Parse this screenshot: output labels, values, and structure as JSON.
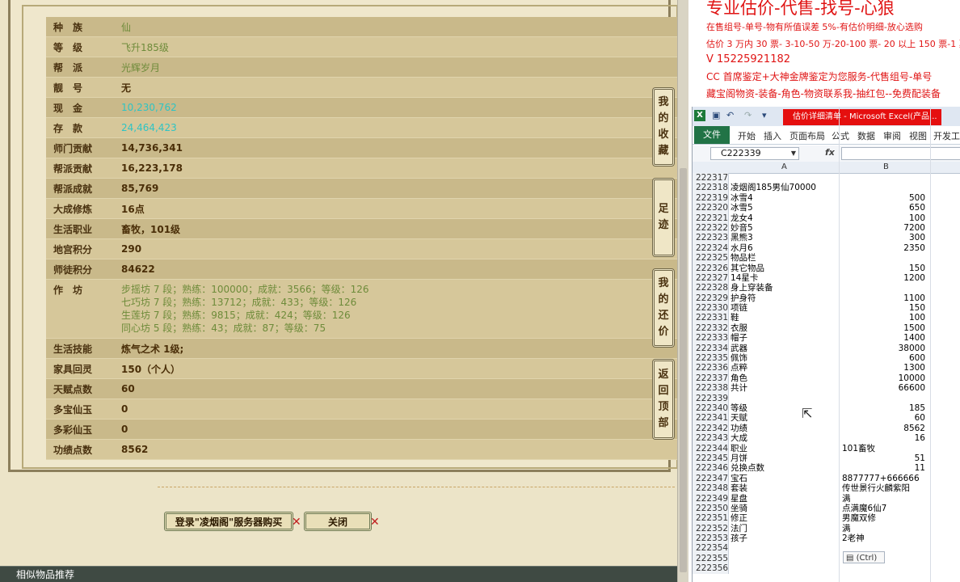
{
  "stats": [
    {
      "label": "种　族",
      "value": "仙",
      "style": "green"
    },
    {
      "label": "等　级",
      "value": "飞升185级",
      "style": "green"
    },
    {
      "label": "帮　派",
      "value": "光辉岁月",
      "style": "green"
    },
    {
      "label": "靓　号",
      "value": "无",
      "style": "bold"
    },
    {
      "label": "现　金",
      "value": "10,230,762",
      "style": "cyan"
    },
    {
      "label": "存　款",
      "value": "24,464,423",
      "style": "cyan"
    },
    {
      "label": "师门贡献",
      "value": "14,736,341",
      "style": "bold"
    },
    {
      "label": "帮派贡献",
      "value": "16,223,178",
      "style": "bold"
    },
    {
      "label": "帮派成就",
      "value": "85,769",
      "style": "bold"
    },
    {
      "label": "大成修炼",
      "value": "16点",
      "style": "bold"
    },
    {
      "label": "生活职业",
      "value": "畜牧，101级",
      "style": "bold"
    },
    {
      "label": "地宫积分",
      "value": "290",
      "style": "bold"
    },
    {
      "label": "师徒积分",
      "value": "84622",
      "style": "bold"
    }
  ],
  "workshop": {
    "label": "作　坊",
    "lines": [
      "步摇坊 7 段；熟练：100000；成就：3566；等级：126",
      "七巧坊 7 段；熟练：13712；成就：433；等级：126",
      "生莲坊 7 段；熟练：9815；成就：424；等级：126",
      "同心坊 5 段；熟练：43；成就：87；等级：75"
    ]
  },
  "stats2": [
    {
      "label": "生活技能",
      "value": "炼气之术 1级;"
    },
    {
      "label": "家具回灵",
      "value": "150（个人）"
    },
    {
      "label": "天赋点数",
      "value": "60"
    },
    {
      "label": "多宝仙玉",
      "value": "0"
    },
    {
      "label": "多彩仙玉",
      "value": "0"
    },
    {
      "label": "功绩点数",
      "value": "8562"
    }
  ],
  "side_buttons": {
    "favorite": [
      "我",
      "的",
      "收",
      "藏"
    ],
    "footprint": [
      "足",
      "迹"
    ],
    "my_offer": [
      "我",
      "的",
      "还",
      "价"
    ],
    "back_top": [
      "返",
      "回",
      "顶",
      "部"
    ]
  },
  "actions": {
    "login_buy": "登录\"凌烟阁\"服务器购买",
    "close": "关闭"
  },
  "similar_bar": "相似物品推荐",
  "doc": {
    "line0": "专业估价-代售-找号-心狼",
    "line1": "在售组号-单号-物有所值误差 5%-有估价明细-放心选购",
    "line2": "估价 3 万内 30 票- 3-10-50 万-20-100 票- 20 以上 150 票-1 票",
    "line3": "V 15225921182",
    "line4": "CC 首席鉴定+大神金牌鉴定为您服务-代售组号-单号",
    "line5": "藏宝阁物资-装备-角色-物资联系我-抽红包--免费配装备"
  },
  "excel": {
    "app_icon": "X",
    "title": "估价详细清单 - Microsoft Excel(产品...",
    "tabs": [
      "开始",
      "插入",
      "页面布局",
      "公式",
      "数据",
      "审阅",
      "视图",
      "开发工具"
    ],
    "file_tab": "文件",
    "name_box": "C222339",
    "fx": "fx",
    "col_a": "A",
    "col_b": "B",
    "paste": "(Ctrl)",
    "rows": [
      {
        "n": "222317",
        "a": "",
        "b": ""
      },
      {
        "n": "222318",
        "a": "凌烟阁185男仙70000",
        "b": ""
      },
      {
        "n": "222319",
        "a": "冰雪4",
        "b": "500"
      },
      {
        "n": "222320",
        "a": "冰雪5",
        "b": "650"
      },
      {
        "n": "222321",
        "a": "龙女4",
        "b": "100"
      },
      {
        "n": "222322",
        "a": "妙音5",
        "b": "7200"
      },
      {
        "n": "222323",
        "a": "黑熊3",
        "b": "300"
      },
      {
        "n": "222324",
        "a": "水月6",
        "b": "2350"
      },
      {
        "n": "222325",
        "a": "物品栏",
        "b": ""
      },
      {
        "n": "222326",
        "a": "其它物品",
        "b": "150"
      },
      {
        "n": "222327",
        "a": "14星卡",
        "b": "1200"
      },
      {
        "n": "222328",
        "a": "身上穿装备",
        "b": ""
      },
      {
        "n": "222329",
        "a": "护身符",
        "b": "1100"
      },
      {
        "n": "222330",
        "a": "项链",
        "b": "150"
      },
      {
        "n": "222331",
        "a": "鞋",
        "b": "100"
      },
      {
        "n": "222332",
        "a": "衣服",
        "b": "1500"
      },
      {
        "n": "222333",
        "a": "帽子",
        "b": "1400"
      },
      {
        "n": "222334",
        "a": "武器",
        "b": "38000"
      },
      {
        "n": "222335",
        "a": "佩饰",
        "b": "600"
      },
      {
        "n": "222336",
        "a": "点粹",
        "b": "1300"
      },
      {
        "n": "222337",
        "a": "角色",
        "b": "10000"
      },
      {
        "n": "222338",
        "a": "共计",
        "b": "66600"
      },
      {
        "n": "222339",
        "a": "",
        "b": ""
      },
      {
        "n": "222340",
        "a": "等级",
        "b": "185"
      },
      {
        "n": "222341",
        "a": "天赋",
        "b": "60"
      },
      {
        "n": "222342",
        "a": "功绩",
        "b": "8562"
      },
      {
        "n": "222343",
        "a": "大成",
        "b": "16"
      },
      {
        "n": "222344",
        "a": "职业",
        "bl": "101畜牧"
      },
      {
        "n": "222345",
        "a": "月饼",
        "b": "51"
      },
      {
        "n": "222346",
        "a": "兑换点数",
        "b": "11"
      },
      {
        "n": "222347",
        "a": "宝石",
        "bl": "8877777+666666"
      },
      {
        "n": "222348",
        "a": "套装",
        "bl": "传世景行火麟紫阳"
      },
      {
        "n": "222349",
        "a": "星盘",
        "bl": "满"
      },
      {
        "n": "222350",
        "a": "坐骑",
        "bl": "点满魔6仙7"
      },
      {
        "n": "222351",
        "a": "修正",
        "bl": "男魔双修"
      },
      {
        "n": "222352",
        "a": "法门",
        "bl": "满"
      },
      {
        "n": "222353",
        "a": "孩子",
        "bl": "2老神"
      },
      {
        "n": "222354",
        "a": "",
        "b": ""
      },
      {
        "n": "222355",
        "a": "",
        "b": ""
      },
      {
        "n": "222356",
        "a": "",
        "b": ""
      }
    ]
  }
}
